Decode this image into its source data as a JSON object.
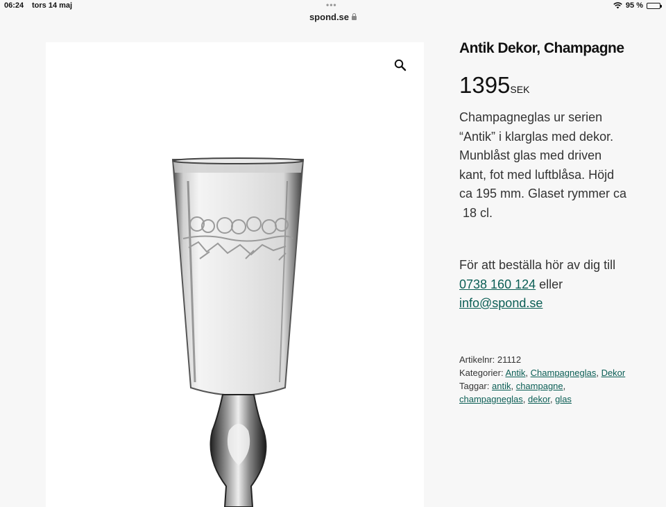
{
  "status": {
    "time": "06:24",
    "date": "tors 14 maj",
    "dots": "•••",
    "battery_text": "95 %",
    "battery_level": 0.95
  },
  "browser": {
    "url": "spond.se"
  },
  "product": {
    "title": "Antik Dekor, Champagne",
    "price": "1395",
    "currency": "SEK",
    "description": [
      "Champagneglas ur serien",
      "“Antik” i klarglas med dekor.",
      "Munblåst glas med driven",
      "kant, fot med luftblåsa. Höjd",
      "ca 195 mm. Glaset rymmer ca",
      " 18 cl."
    ],
    "order": {
      "line1": "För att beställa hör av dig till",
      "phone": "0738 160 124",
      "or": "eller",
      "email": "info@spond.se"
    },
    "meta": {
      "sku_label": "Artikelnr:",
      "sku": "21112",
      "categories_label": "Kategorier:",
      "categories": [
        "Antik",
        "Champagneglas",
        "Dekor"
      ],
      "tags_label": "Taggar:",
      "tags": [
        "antik",
        "champagne",
        "champagneglas",
        "dekor",
        "glas"
      ]
    }
  },
  "icons": {
    "zoom": "magnifier-icon",
    "wifi": "wifi-icon",
    "battery": "battery-icon",
    "lock": "lock-icon"
  },
  "colors": {
    "link": "#0b5e55",
    "page_bg": "#f7f7f7"
  }
}
